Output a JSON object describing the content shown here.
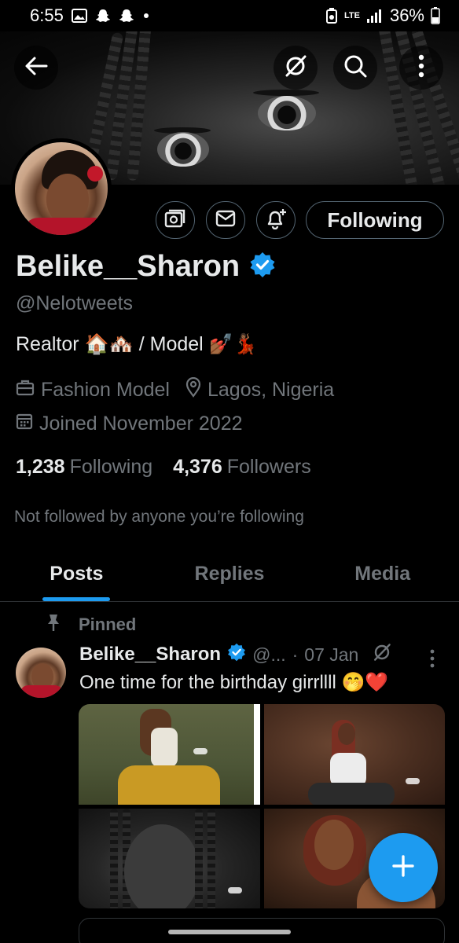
{
  "status_bar": {
    "time": "6:55",
    "network": "LTE",
    "battery": "36%",
    "icons": [
      "gallery-icon",
      "snapchat-icon",
      "snapchat-icon",
      "dot-icon",
      "recycle-icon",
      "signal-icon",
      "battery-icon"
    ]
  },
  "header": {
    "icons": [
      "back-arrow-icon",
      "grok-icon",
      "search-icon",
      "more-vertical-icon"
    ]
  },
  "profile": {
    "name": "Belike__Sharon",
    "handle": "@Nelotweets",
    "bio": "Realtor 🏠🏘️  / Model 💅🏾💃🏾",
    "category": "Fashion Model",
    "location": "Lagos, Nigeria",
    "joined": "Joined November 2022",
    "following_count": "1,238",
    "following_label": "Following",
    "followers_count": "4,376",
    "followers_label": "Followers",
    "not_followed_text": "Not followed by anyone you’re following",
    "verified_color": "#1d9bf0",
    "action_icons": [
      "subscribe-icon",
      "message-icon",
      "notifications-add-icon"
    ],
    "follow_button_label": "Following"
  },
  "tabs": [
    {
      "label": "Posts",
      "active": true
    },
    {
      "label": "Replies",
      "active": false
    },
    {
      "label": "Media",
      "active": false
    }
  ],
  "post": {
    "pinned_label": "Pinned",
    "author_name": "Belike__Sharon",
    "author_handle": "@...",
    "separator": "·",
    "date": "07 Jan",
    "text": "One time for the birthday girrllll 🤭❤️",
    "photo_count": 4
  },
  "colors": {
    "background": "#000000",
    "accent": "#1d9bf0",
    "primary_text": "#e7e9ea",
    "secondary_text": "#71767b",
    "border": "#2f3336"
  }
}
